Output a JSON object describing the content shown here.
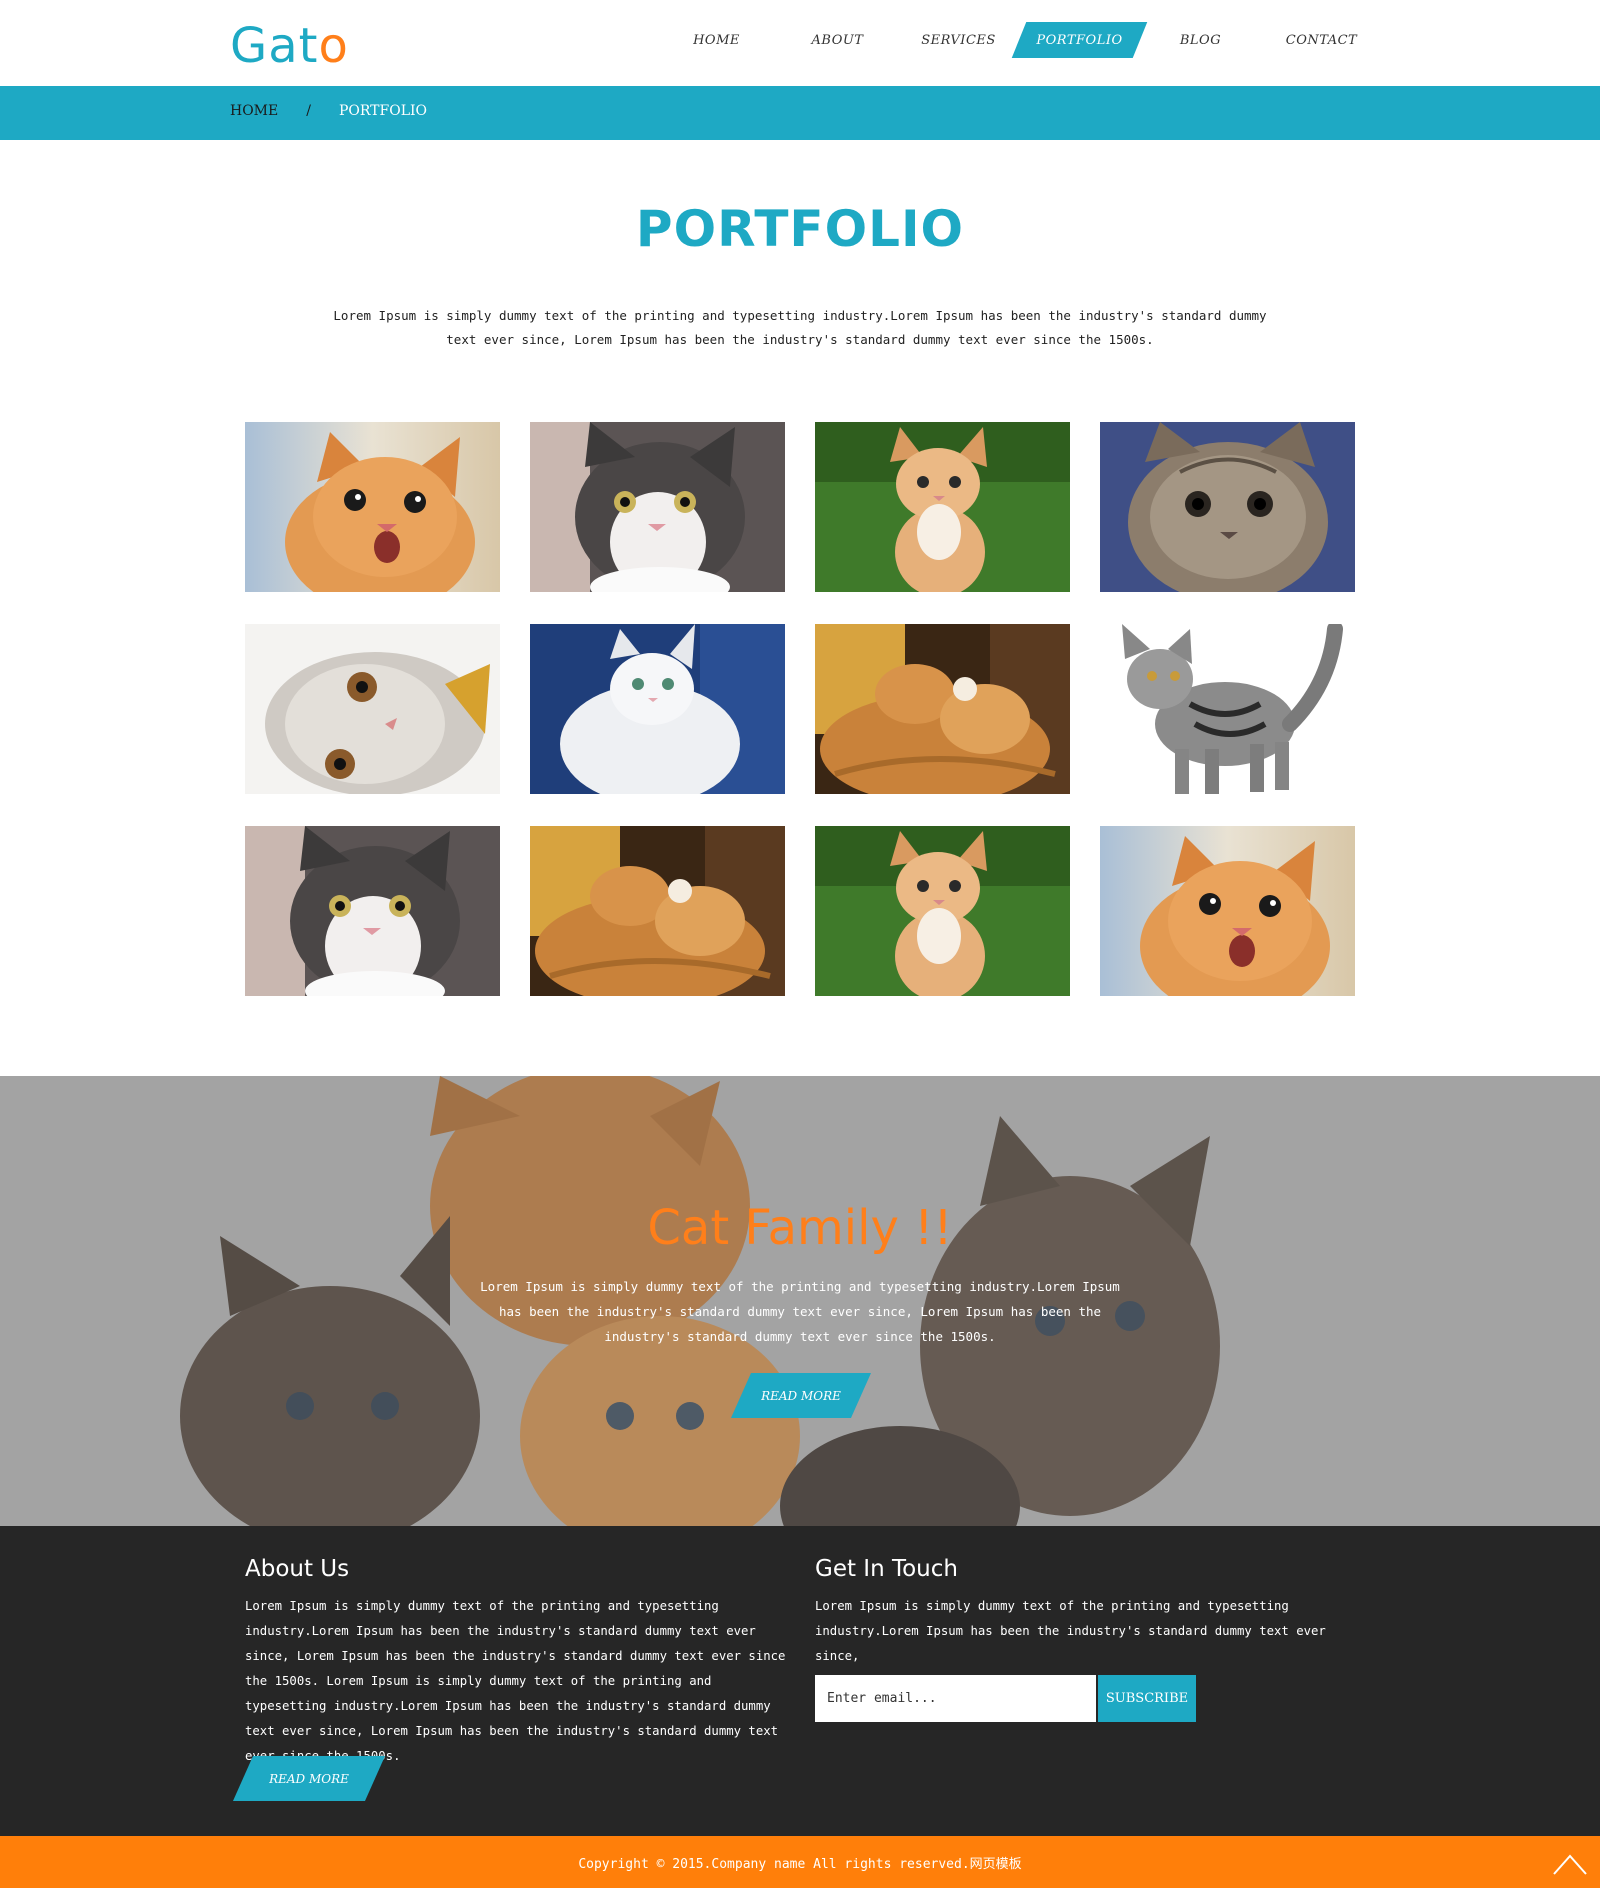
{
  "brand": {
    "logo_part1": "Gat",
    "logo_part2": "o"
  },
  "nav": {
    "items": [
      {
        "label": "HOME"
      },
      {
        "label": "ABOUT"
      },
      {
        "label": "SERVICES"
      },
      {
        "label": "PORTFOLIO",
        "active": true
      },
      {
        "label": "BLOG"
      },
      {
        "label": "CONTACT"
      }
    ]
  },
  "breadcrumb": {
    "home": "HOME",
    "separator": "/",
    "current": "PORTFOLIO"
  },
  "portfolio": {
    "title": "PORTFOLIO",
    "description": "Lorem Ipsum is simply dummy text of the printing and typesetting industry.Lorem Ipsum has been the industry's standard dummy text ever since, Lorem Ipsum has been the industry's standard dummy text ever since the 1500s.",
    "images": [
      "orange-kitten-meowing",
      "gray-white-kitten",
      "orange-kitten-on-grass",
      "tabby-kitten-closeup",
      "silver-kitten-lying",
      "white-persian-cat",
      "two-orange-cats-cuddling",
      "silver-tabby-kitten-standing",
      "gray-white-kitten",
      "two-orange-cats-cuddling",
      "orange-kitten-on-grass",
      "orange-kitten-meowing"
    ]
  },
  "hero": {
    "title": "Cat Family !!",
    "text": "Lorem Ipsum is simply dummy text of the printing and typesetting industry.Lorem Ipsum has been the industry's standard dummy text ever since, Lorem Ipsum has been the industry's standard dummy text ever since the 1500s.",
    "button": "READ MORE",
    "image": "kittens-group-photo"
  },
  "footer": {
    "about": {
      "title": "About Us",
      "text": "Lorem Ipsum is simply dummy text of the printing and typesetting industry.Lorem Ipsum has been the industry's standard dummy text ever since, Lorem Ipsum has been the industry's standard dummy text ever since the 1500s. Lorem Ipsum is simply dummy text of the printing and typesetting industry.Lorem Ipsum has been the industry's standard dummy text ever since, Lorem Ipsum has been the industry's standard dummy text ever since the 1500s.",
      "button": "READ MORE"
    },
    "touch": {
      "title": "Get In Touch",
      "text": "Lorem Ipsum is simply dummy text of the printing and typesetting industry.Lorem Ipsum has been the industry's standard dummy text ever since,",
      "email_placeholder": "Enter email...",
      "subscribe": "SUBSCRIBE"
    }
  },
  "copyright": {
    "text": "Copyright © 2015.Company name All rights reserved.网页模板",
    "to_top_icon": "chevron-up-icon"
  },
  "colors": {
    "accent": "#1ea9c4",
    "orange": "#ff7f0a",
    "dark": "#262626"
  }
}
